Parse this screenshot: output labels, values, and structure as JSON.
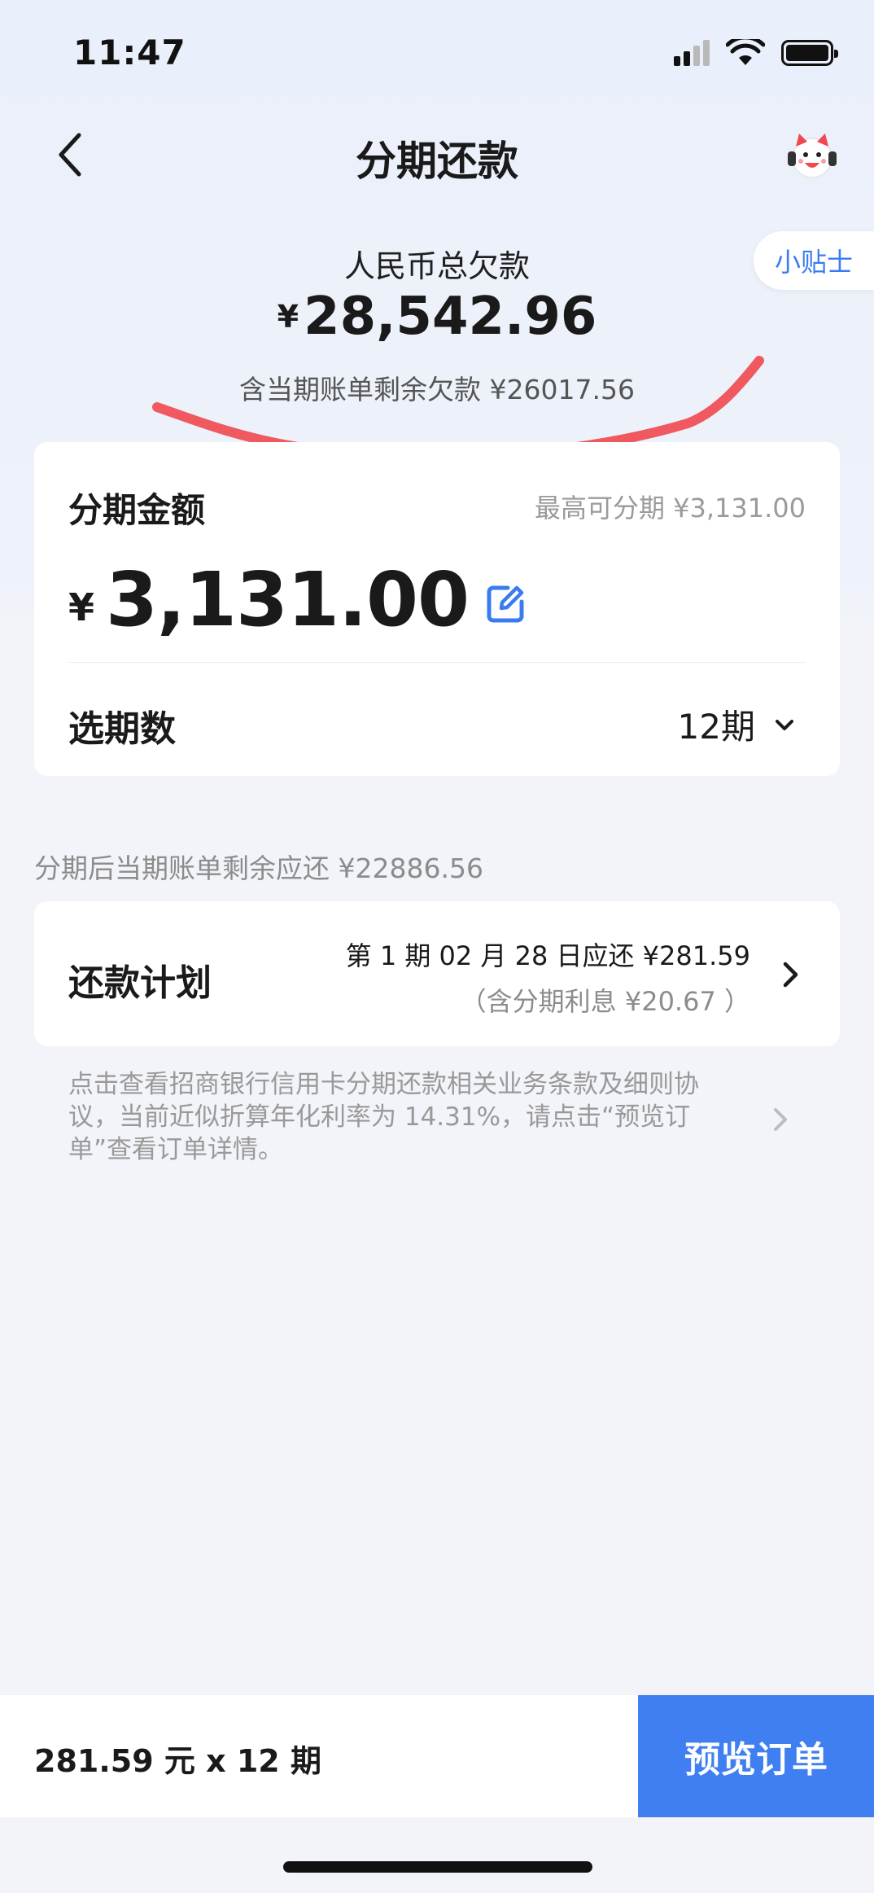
{
  "status_bar": {
    "time": "11:47"
  },
  "nav": {
    "title": "分期还款"
  },
  "tips": {
    "label": "小贴士"
  },
  "debt": {
    "label": "人民币总欠款",
    "currency": "¥",
    "amount": "28,542.96",
    "sub": "含当期账单剩余欠款 ¥26017.56"
  },
  "installment": {
    "label": "分期金额",
    "max": "最高可分期 ¥3,131.00",
    "currency": "¥",
    "amount": "3,131.00",
    "period_label": "选期数",
    "period_value": "12期"
  },
  "after_text": "分期后当期账单剩余应还 ¥22886.56",
  "plan": {
    "label": "还款计划",
    "line1": "第 1 期 02 月 28 日应还  ¥281.59",
    "line2": "（含分期利息  ¥20.67 ）"
  },
  "terms": "点击查看招商银行信用卡分期还款相关业务条款及细则协议，当前近似折算年化利率为 14.31%，请点击“预览订单”查看订单详情。",
  "bottom": {
    "summary": "281.59 元 x 12 期",
    "button": "预览订单"
  },
  "colors": {
    "accent": "#3f7ff2",
    "tips_text": "#3a7cf0",
    "annotation_red": "#f0484e"
  }
}
